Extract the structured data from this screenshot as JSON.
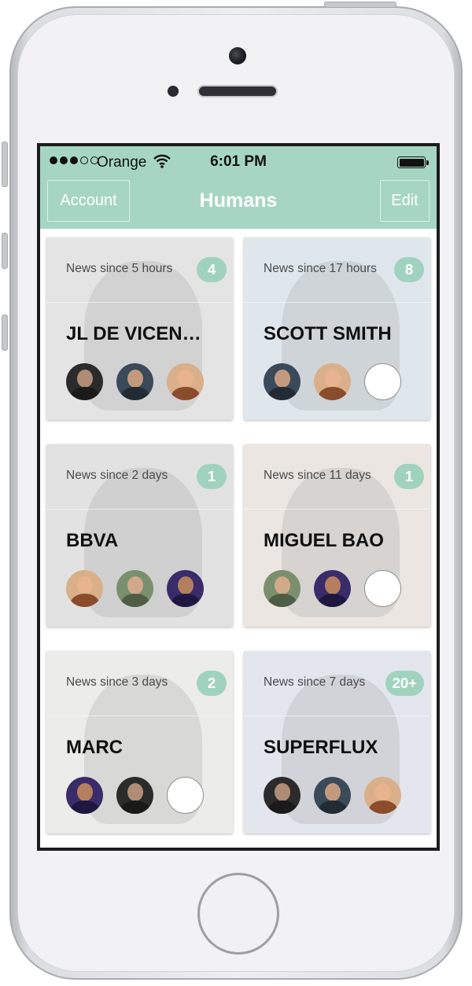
{
  "status_bar": {
    "carrier": "Orange",
    "time": "6:01 PM",
    "signal_bars": 3,
    "signal_max": 5
  },
  "nav": {
    "left_button": "Account",
    "title": "Humans",
    "right_button": "Edit"
  },
  "colors": {
    "accent": "#a6d6c3",
    "badge": "#a0d3bf"
  },
  "contacts": [
    {
      "news": "News since 5 hours",
      "badge": "4",
      "name": "JL DE VICEN…",
      "tint": "#e4e4e4",
      "avatars": [
        "person-photo",
        "person-photo",
        "person-photo"
      ]
    },
    {
      "news": "News since 17 hours",
      "badge": "8",
      "name": "SCOTT SMITH",
      "tint": "#dfe7ec",
      "avatars": [
        "person-photo",
        "person-photo",
        "empty"
      ]
    },
    {
      "news": "News since 2 days",
      "badge": "1",
      "name": "BBVA",
      "tint": "#e2e2e2",
      "avatars": [
        "person-photo",
        "person-photo",
        "person-photo"
      ]
    },
    {
      "news": "News since 11 days",
      "badge": "1",
      "name": "MIGUEL BAO",
      "tint": "#ebe6e2",
      "avatars": [
        "person-photo",
        "person-photo",
        "empty"
      ]
    },
    {
      "news": "News since 3 days",
      "badge": "2",
      "name": "MARC",
      "tint": "#ececea",
      "avatars": [
        "person-photo",
        "person-photo",
        "empty"
      ]
    },
    {
      "news": "News since 7 days",
      "badge": "20+",
      "name": "SUPERFLUX",
      "tint": "#e4e6ee",
      "avatars": [
        "person-photo",
        "person-photo",
        "person-photo"
      ]
    }
  ]
}
